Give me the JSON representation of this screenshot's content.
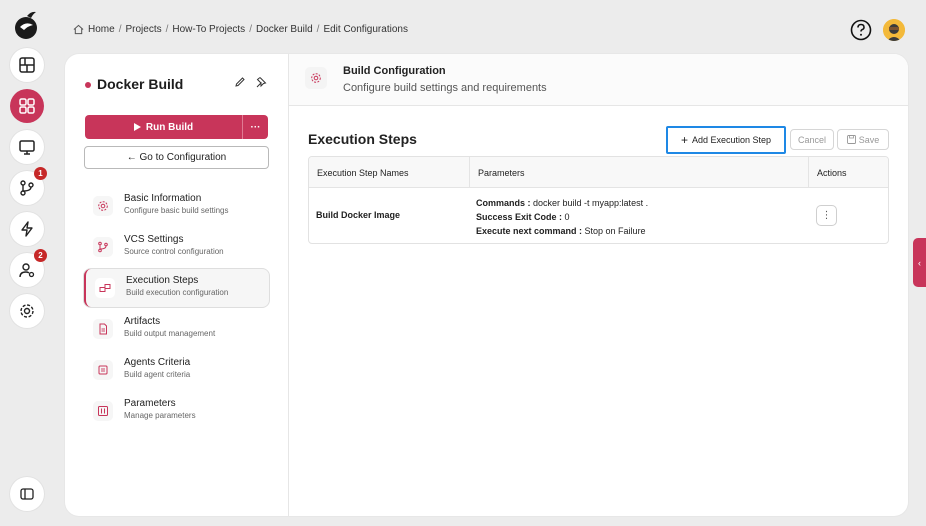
{
  "breadcrumb": {
    "items": [
      "Home",
      "Projects",
      "How-To Projects",
      "Docker Build",
      "Edit Configurations"
    ],
    "separator": "/"
  },
  "rail": {
    "badges": {
      "vcs": "1",
      "users": "2"
    }
  },
  "project": {
    "title": "Docker Build",
    "run_label": "Run Build",
    "more_label": "···",
    "goto_label": "← Go to Configuration"
  },
  "nav": [
    {
      "label": "Basic Information",
      "sub": "Configure basic build settings",
      "icon": "gear-icon"
    },
    {
      "label": "VCS Settings",
      "sub": "Source control configuration",
      "icon": "branch-icon"
    },
    {
      "label": "Execution Steps",
      "sub": "Build execution configuration",
      "icon": "steps-icon"
    },
    {
      "label": "Artifacts",
      "sub": "Build output management",
      "icon": "file-icon"
    },
    {
      "label": "Agents Criteria",
      "sub": "Build agent criteria",
      "icon": "agent-icon"
    },
    {
      "label": "Parameters",
      "sub": "Manage parameters",
      "icon": "params-icon"
    }
  ],
  "header": {
    "title": "Build Configuration",
    "subtitle": "Configure build settings and requirements"
  },
  "section": {
    "title": "Execution Steps",
    "add_label": "Add Execution Step",
    "cancel_label": "Cancel",
    "save_label": "Save"
  },
  "table": {
    "columns": [
      "Execution Step Names",
      "Parameters",
      "Actions"
    ],
    "rows": [
      {
        "name": "Build Docker Image",
        "params": [
          {
            "key": "Commands :",
            "value": " docker build -t myapp:latest ."
          },
          {
            "key": "Success Exit Code :",
            "value": " 0"
          },
          {
            "key": "Execute next command :",
            "value": " Stop on Failure"
          }
        ],
        "action": "⋮"
      }
    ]
  },
  "colors": {
    "accent": "#c8355a",
    "focus": "#1e88e5"
  }
}
